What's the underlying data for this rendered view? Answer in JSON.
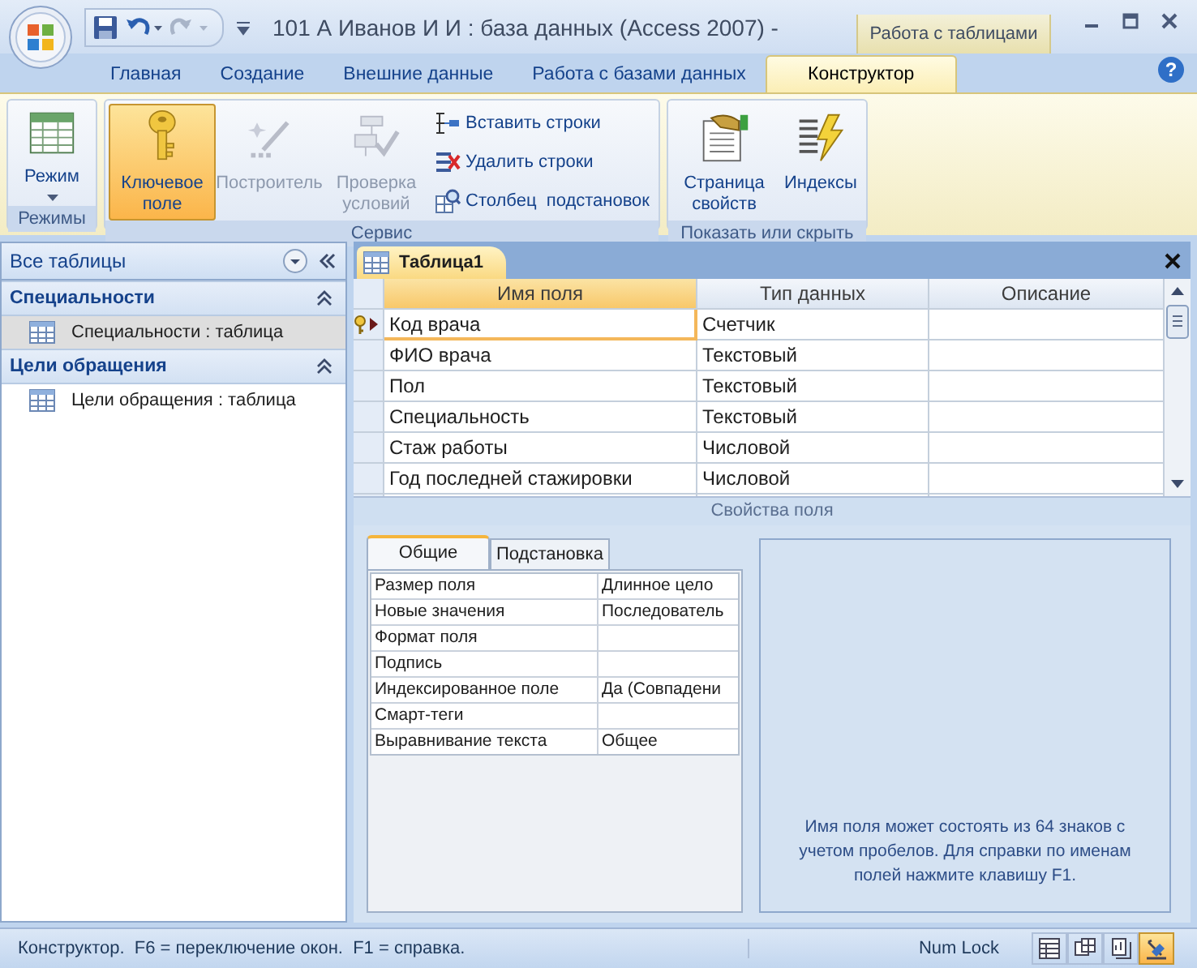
{
  "window": {
    "title": "101 А Иванов И И : база данных (Access 2007) -",
    "context_tab": "Работа с таблицами",
    "help_button": "?"
  },
  "ribbon_tabs": [
    {
      "label": "Главная",
      "selected": false
    },
    {
      "label": "Создание",
      "selected": false
    },
    {
      "label": "Внешние данные",
      "selected": false
    },
    {
      "label": "Работа с базами данных",
      "selected": false
    },
    {
      "label": "Конструктор",
      "selected": true
    }
  ],
  "ribbon_groups": [
    {
      "label": "Режимы",
      "buttons": [
        {
          "label": "Режим",
          "kind": "dropdown",
          "pressed": false,
          "disabled": false
        }
      ]
    },
    {
      "label": "Сервис",
      "buttons": [
        {
          "label": "Ключевое поле",
          "kind": "large",
          "pressed": true,
          "disabled": false
        },
        {
          "label": "Построитель",
          "kind": "large",
          "pressed": false,
          "disabled": true
        },
        {
          "label": "Проверка условий",
          "kind": "large",
          "pressed": false,
          "disabled": true
        },
        {
          "label": "Вставить строки",
          "kind": "small",
          "pressed": false,
          "disabled": false
        },
        {
          "label": "Удалить строки",
          "kind": "small",
          "pressed": false,
          "disabled": false
        },
        {
          "label": "Столбец  подстановок",
          "kind": "small",
          "pressed": false,
          "disabled": false
        }
      ]
    },
    {
      "label": "Показать или скрыть",
      "buttons": [
        {
          "label": "Страница свойств",
          "kind": "large",
          "pressed": false,
          "disabled": false
        },
        {
          "label": "Индексы",
          "kind": "large",
          "pressed": false,
          "disabled": false
        }
      ]
    }
  ],
  "nav_pane": {
    "title": "Все таблицы",
    "groups": [
      {
        "label": "Специальности",
        "expanded": true,
        "items": [
          {
            "label": "Специальности : таблица",
            "selected": true
          }
        ]
      },
      {
        "label": "Цели обращения",
        "expanded": true,
        "items": [
          {
            "label": "Цели обращения : таблица",
            "selected": false
          }
        ]
      }
    ]
  },
  "document": {
    "tab": "Таблица1",
    "columns": [
      "Имя поля",
      "Тип данных",
      "Описание"
    ],
    "rows": [
      {
        "name": "Код врача",
        "type": "Счетчик",
        "primary_key": true,
        "selected": true
      },
      {
        "name": "ФИО врача",
        "type": "Текстовый",
        "primary_key": false,
        "selected": false
      },
      {
        "name": "Пол",
        "type": "Текстовый",
        "primary_key": false,
        "selected": false
      },
      {
        "name": "Специальность",
        "type": "Текстовый",
        "primary_key": false,
        "selected": false
      },
      {
        "name": "Стаж работы",
        "type": "Числовой",
        "primary_key": false,
        "selected": false
      },
      {
        "name": "Год последней стажировки",
        "type": "Числовой",
        "primary_key": false,
        "selected": false
      }
    ],
    "properties_label": "Свойства поля",
    "property_tabs": [
      {
        "label": "Общие",
        "selected": true
      },
      {
        "label": "Подстановка",
        "selected": false
      }
    ],
    "properties": [
      {
        "name": "Размер поля",
        "value": "Длинное цело"
      },
      {
        "name": "Новые значения",
        "value": "Последователь"
      },
      {
        "name": "Формат поля"
      },
      {
        "name": "Подпись"
      },
      {
        "name": "Индексированное поле",
        "value": "Да (Совпадени"
      },
      {
        "name": "Смарт-теги"
      },
      {
        "name": "Выравнивание текста",
        "value": "Общее"
      }
    ],
    "help": "Имя поля может состоять из 64 знаков с учетом пробелов.  Для справки по именам полей нажмите клавишу F1."
  },
  "status_bar": {
    "text": "Конструктор.  F6 = переключение окон.  F1 = справка.",
    "indicator": "Num Lock",
    "views": [
      {
        "selected": false
      },
      {
        "selected": false
      },
      {
        "selected": false
      },
      {
        "selected": true
      }
    ]
  }
}
